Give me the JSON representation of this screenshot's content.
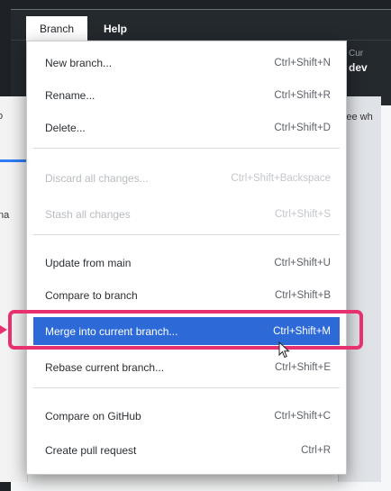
{
  "menubar": {
    "branch_label": "Branch",
    "help_label": "Help"
  },
  "background": {
    "toolbar": {
      "current_branch_label": "Cur",
      "current_branch_value": "dev"
    },
    "left_text_a": "o",
    "left_text_b": "na",
    "right_text": "See wh"
  },
  "menu": {
    "items": [
      {
        "label": "New branch...",
        "shortcut": "Ctrl+Shift+N",
        "enabled": true
      },
      {
        "label": "Rename...",
        "shortcut": "Ctrl+Shift+R",
        "enabled": true
      },
      {
        "label": "Delete...",
        "shortcut": "Ctrl+Shift+D",
        "enabled": true
      },
      {
        "label": "Discard all changes...",
        "shortcut": "Ctrl+Shift+Backspace",
        "enabled": false
      },
      {
        "label": "Stash all changes",
        "shortcut": "Ctrl+Shift+S",
        "enabled": false
      },
      {
        "label": "Update from main",
        "shortcut": "Ctrl+Shift+U",
        "enabled": true
      },
      {
        "label": "Compare to branch",
        "shortcut": "Ctrl+Shift+B",
        "enabled": true
      },
      {
        "label": "Merge into current branch...",
        "shortcut": "Ctrl+Shift+M",
        "enabled": true,
        "highlighted": true
      },
      {
        "label": "Rebase current branch...",
        "shortcut": "Ctrl+Shift+E",
        "enabled": true
      },
      {
        "label": "Compare on GitHub",
        "shortcut": "Ctrl+Shift+C",
        "enabled": true
      },
      {
        "label": "Create pull request",
        "shortcut": "Ctrl+R",
        "enabled": true
      }
    ]
  },
  "colors": {
    "highlight": "#2d6ad8",
    "focus_ring": "#e7306e",
    "titlebar": "#24292e"
  },
  "icons": {
    "branch": "git-branch-icon",
    "cursor": "mouse-pointer-icon"
  }
}
